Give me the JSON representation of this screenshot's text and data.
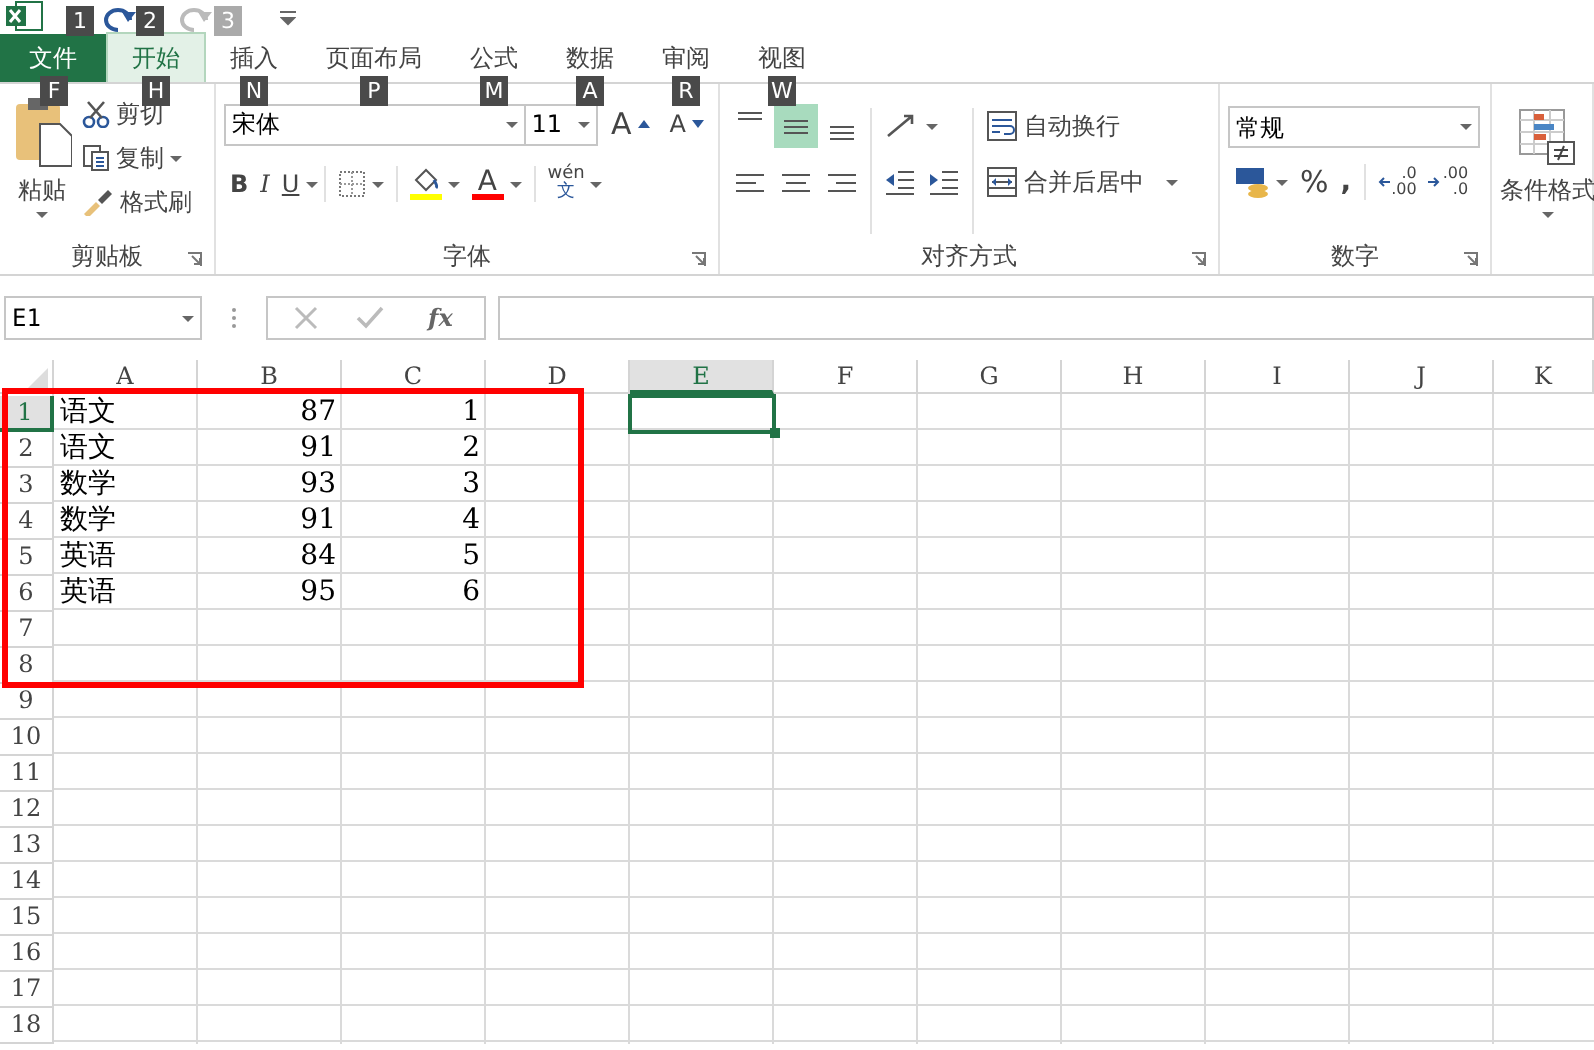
{
  "quick_access": [
    {
      "kind": "undo",
      "key_tip": "1",
      "disabled": false
    },
    {
      "kind": "redo",
      "key_tip": "2",
      "disabled": false
    },
    {
      "kind": "redo",
      "key_tip": "3",
      "disabled": true
    }
  ],
  "tabs": [
    {
      "label": "文件",
      "key_tip": "F",
      "kind": "file",
      "selected": false
    },
    {
      "label": "开始",
      "key_tip": "H",
      "kind": "tab",
      "selected": true
    },
    {
      "label": "插入",
      "key_tip": "N",
      "kind": "tab",
      "selected": false
    },
    {
      "label": "页面布局",
      "key_tip": "P",
      "kind": "tab",
      "selected": false
    },
    {
      "label": "公式",
      "key_tip": "M",
      "kind": "tab",
      "selected": false
    },
    {
      "label": "数据",
      "key_tip": "A",
      "kind": "tab",
      "selected": false
    },
    {
      "label": "审阅",
      "key_tip": "R",
      "kind": "tab",
      "selected": false
    },
    {
      "label": "视图",
      "key_tip": "W",
      "kind": "tab",
      "selected": false
    }
  ],
  "clipboard": {
    "paste": "粘贴",
    "cut": "剪切",
    "copy": "复制",
    "format_painter": "格式刷",
    "label": "剪贴板"
  },
  "font": {
    "name": "宋体",
    "size": "11",
    "grow": "A",
    "shrink": "A",
    "bold": "B",
    "italic": "I",
    "underline": "U",
    "font_color_letter": "A",
    "phonetic_top": "wén",
    "phonetic_bottom": "文",
    "label": "字体"
  },
  "alignment": {
    "vertical": [
      {
        "selected": false
      },
      {
        "selected": true
      },
      {
        "selected": false
      }
    ],
    "wrap_text": "自动换行",
    "merge_center": "合并后居中",
    "label": "对齐方式"
  },
  "number": {
    "format": "常规",
    "percent": "%",
    "comma": ",",
    "increase_decimal": [
      ".0",
      ".00"
    ],
    "decrease_decimal": [
      ".00",
      ".0"
    ],
    "label": "数字"
  },
  "styles": {
    "conditional_format": "条件格式"
  },
  "formula_bar": {
    "name_box": "E1",
    "fx": "fx"
  },
  "columns": [
    {
      "letter": "A",
      "selected": false
    },
    {
      "letter": "B",
      "selected": false
    },
    {
      "letter": "C",
      "selected": false
    },
    {
      "letter": "D",
      "selected": false
    },
    {
      "letter": "E",
      "selected": true
    },
    {
      "letter": "F",
      "selected": false
    },
    {
      "letter": "G",
      "selected": false
    },
    {
      "letter": "H",
      "selected": false
    },
    {
      "letter": "I",
      "selected": false
    },
    {
      "letter": "J",
      "selected": false
    },
    {
      "letter": "K",
      "selected": false
    }
  ],
  "rows": [
    {
      "number": "1",
      "selected": true,
      "cells": [
        {
          "kind": "text",
          "value": "语文"
        },
        {
          "kind": "number",
          "value": "87"
        },
        {
          "kind": "number",
          "value": "1"
        }
      ]
    },
    {
      "number": "2",
      "selected": false,
      "cells": [
        {
          "kind": "text",
          "value": "语文"
        },
        {
          "kind": "number",
          "value": "91"
        },
        {
          "kind": "number",
          "value": "2"
        }
      ]
    },
    {
      "number": "3",
      "selected": false,
      "cells": [
        {
          "kind": "text",
          "value": "数学"
        },
        {
          "kind": "number",
          "value": "93"
        },
        {
          "kind": "number",
          "value": "3"
        }
      ]
    },
    {
      "number": "4",
      "selected": false,
      "cells": [
        {
          "kind": "text",
          "value": "数学"
        },
        {
          "kind": "number",
          "value": "91"
        },
        {
          "kind": "number",
          "value": "4"
        }
      ]
    },
    {
      "number": "5",
      "selected": false,
      "cells": [
        {
          "kind": "text",
          "value": "英语"
        },
        {
          "kind": "number",
          "value": "84"
        },
        {
          "kind": "number",
          "value": "5"
        }
      ]
    },
    {
      "number": "6",
      "selected": false,
      "cells": [
        {
          "kind": "text",
          "value": "英语"
        },
        {
          "kind": "number",
          "value": "95"
        },
        {
          "kind": "number",
          "value": "6"
        }
      ]
    },
    {
      "number": "7",
      "selected": false,
      "cells": []
    },
    {
      "number": "8",
      "selected": false,
      "cells": []
    },
    {
      "number": "9",
      "selected": false,
      "cells": []
    },
    {
      "number": "10",
      "selected": false,
      "cells": []
    },
    {
      "number": "11",
      "selected": false,
      "cells": []
    },
    {
      "number": "12",
      "selected": false,
      "cells": []
    },
    {
      "number": "13",
      "selected": false,
      "cells": []
    },
    {
      "number": "14",
      "selected": false,
      "cells": []
    },
    {
      "number": "15",
      "selected": false,
      "cells": []
    },
    {
      "number": "16",
      "selected": false,
      "cells": []
    },
    {
      "number": "17",
      "selected": false,
      "cells": []
    },
    {
      "number": "18",
      "selected": false,
      "cells": []
    }
  ],
  "annotation": {
    "kind": "rectangle",
    "color": "#ff0000"
  }
}
